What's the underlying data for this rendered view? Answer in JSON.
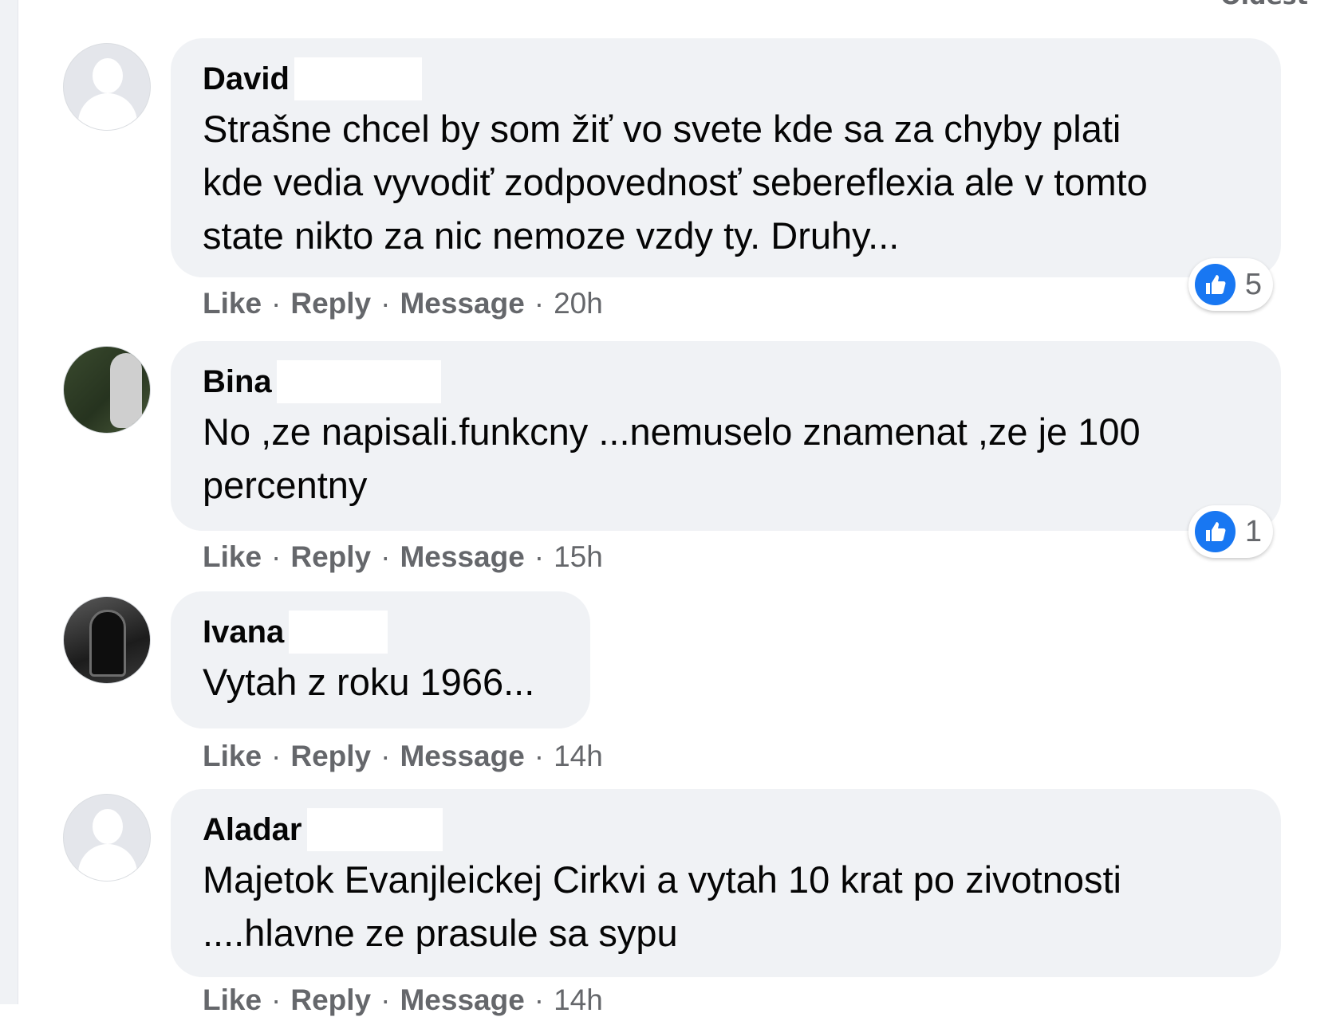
{
  "header": {
    "sort_fragment": "Oldest"
  },
  "comments": [
    {
      "author": "David",
      "text": "Strašne chcel by som žiť vo svete kde sa za chyby plati\nkde vedia vyvodiť zodpovednosť sebereflexia ale v tomto\nstate nikto za nic nemoze vzdy ty. Druhy...",
      "avatar": "default-avatar",
      "like": "Like",
      "reply": "Reply",
      "message": "Message",
      "sep": "·",
      "time": "20h",
      "reactions": "5"
    },
    {
      "author": "Bina",
      "text": "No ,ze napisali.funkcny ...nemuselo znamenat ,ze je 100\npercentny",
      "avatar": "goat-photo-avatar",
      "like": "Like",
      "reply": "Reply",
      "message": "Message",
      "sep": "·",
      "time": "15h",
      "reactions": "1"
    },
    {
      "author": "Ivana",
      "text": "Vytah z roku 1966...",
      "avatar": "dark-photo-avatar",
      "like": "Like",
      "reply": "Reply",
      "message": "Message",
      "sep": "·",
      "time": "14h"
    },
    {
      "author": "Aladar",
      "text": "Majetok Evanjleickej Cirkvi a vytah 10 krat po zivotnosti\n....hlavne ze prasule sa sypu",
      "avatar": "default-avatar",
      "like": "Like",
      "reply": "Reply",
      "message": "Message",
      "sep": "·",
      "time": "14h"
    }
  ],
  "colors": {
    "bubble": "#f0f2f5",
    "meta_text": "#65676b",
    "like_blue": "#1877f2"
  }
}
